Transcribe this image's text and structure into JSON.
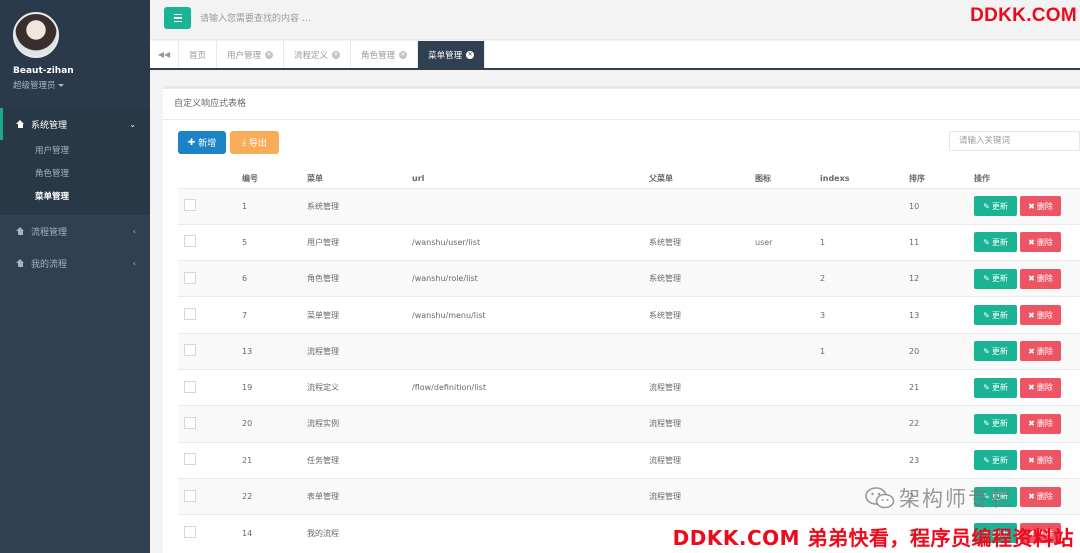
{
  "user": {
    "name": "Beaut-zihan",
    "role": "超级管理员"
  },
  "sidebar": {
    "sections": [
      {
        "label": "系统管理",
        "items": [
          {
            "label": "用户管理"
          },
          {
            "label": "角色管理"
          },
          {
            "label": "菜单管理"
          }
        ]
      },
      {
        "label": "流程管理"
      },
      {
        "label": "我的流程"
      }
    ]
  },
  "topbar": {
    "search_placeholder": "请输入您需要查找的内容 …"
  },
  "tabs": [
    {
      "label": "首页"
    },
    {
      "label": "用户管理"
    },
    {
      "label": "流程定义"
    },
    {
      "label": "角色管理"
    },
    {
      "label": "菜单管理"
    }
  ],
  "panel": {
    "title": "自定义响应式表格",
    "add_label": "新增",
    "export_label": "导出",
    "keyword_placeholder": "请输入关键词"
  },
  "table": {
    "columns": [
      "编号",
      "菜单",
      "url",
      "父菜单",
      "图标",
      "indexs",
      "排序",
      "操作"
    ],
    "update_label": "更新",
    "delete_label": "删除",
    "rows": [
      {
        "id": "1",
        "menu": "系统管理",
        "url": "",
        "parent": "",
        "icon": "",
        "indexs": "",
        "sort": "10"
      },
      {
        "id": "5",
        "menu": "用户管理",
        "url": "/wanshu/user/list",
        "parent": "系统管理",
        "icon": "user",
        "indexs": "1",
        "sort": "11"
      },
      {
        "id": "6",
        "menu": "角色管理",
        "url": "/wanshu/role/list",
        "parent": "系统管理",
        "icon": "",
        "indexs": "2",
        "sort": "12"
      },
      {
        "id": "7",
        "menu": "菜单管理",
        "url": "/wanshu/menu/list",
        "parent": "系统管理",
        "icon": "",
        "indexs": "3",
        "sort": "13"
      },
      {
        "id": "13",
        "menu": "流程管理",
        "url": "",
        "parent": "",
        "icon": "",
        "indexs": "1",
        "sort": "20"
      },
      {
        "id": "19",
        "menu": "流程定义",
        "url": "/flow/definition/list",
        "parent": "流程管理",
        "icon": "",
        "indexs": "",
        "sort": "21"
      },
      {
        "id": "20",
        "menu": "流程实例",
        "url": "",
        "parent": "流程管理",
        "icon": "",
        "indexs": "",
        "sort": "22"
      },
      {
        "id": "21",
        "menu": "任务管理",
        "url": "",
        "parent": "流程管理",
        "icon": "",
        "indexs": "",
        "sort": "23"
      },
      {
        "id": "22",
        "menu": "表单管理",
        "url": "",
        "parent": "流程管理",
        "icon": "",
        "indexs": "",
        "sort": "2"
      },
      {
        "id": "14",
        "menu": "我的流程",
        "url": "",
        "parent": "",
        "icon": "",
        "indexs": "3",
        "sort": "30"
      }
    ]
  },
  "watermarks": {
    "top": "DDKK.COM",
    "wechat": "架构师专栏",
    "bottom": "DDKK.COM 弟弟快看，程序员编程资料站"
  },
  "colors": {
    "sidebar": "#2f4050",
    "primary": "#1ab394",
    "blue": "#1c84c6",
    "warning": "#f8ac59",
    "danger": "#ed5565",
    "watermark": "#ee0a1d"
  }
}
